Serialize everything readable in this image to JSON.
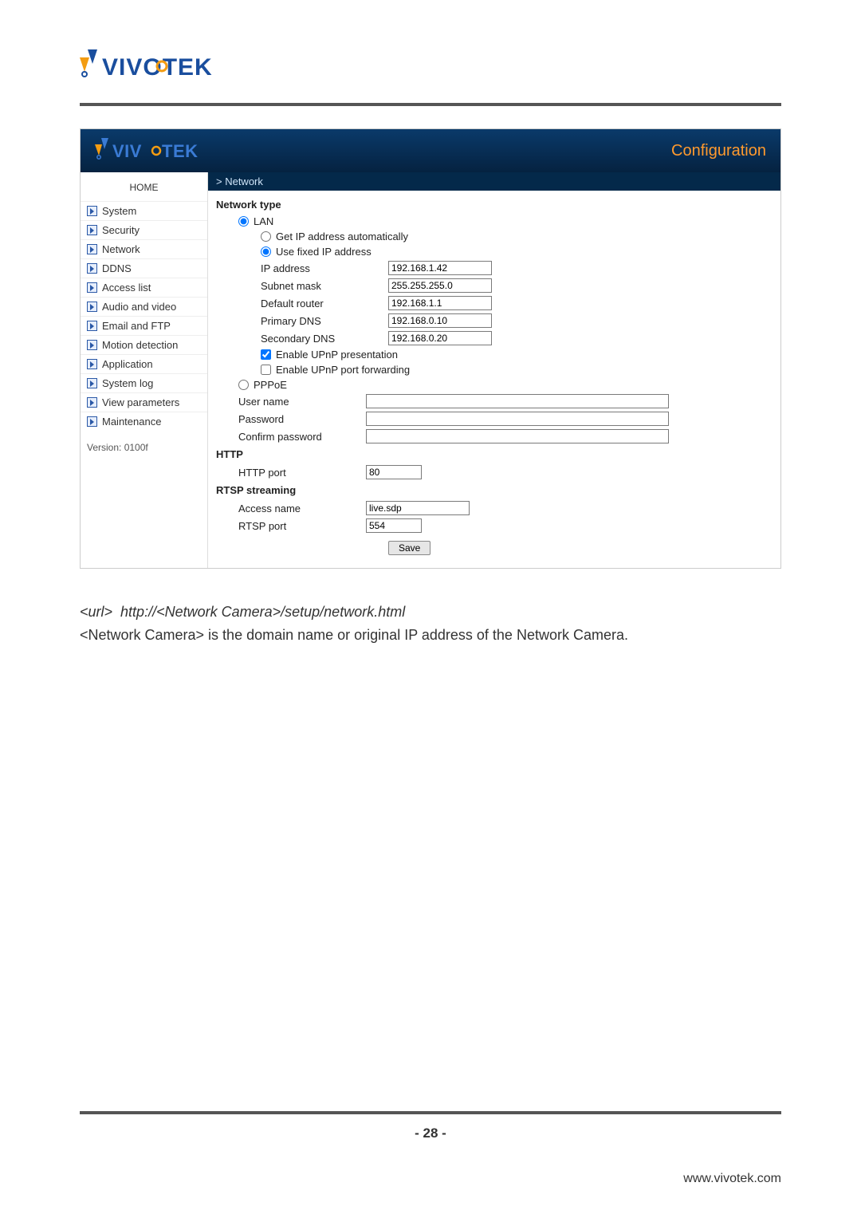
{
  "brand": "VIVOTEK",
  "config_title": "Configuration",
  "breadcrumb": "> Network",
  "sidebar": {
    "home": "HOME",
    "items": [
      "System",
      "Security",
      "Network",
      "DDNS",
      "Access list",
      "Audio and video",
      "Email and FTP",
      "Motion detection",
      "Application",
      "System log",
      "View parameters",
      "Maintenance"
    ],
    "version": "Version: 0100f"
  },
  "sections": {
    "network_type": "Network type",
    "lan": "LAN",
    "get_auto": "Get IP address automatically",
    "use_fixed": "Use fixed IP address",
    "ip_address_lbl": "IP address",
    "ip_address": "192.168.1.42",
    "subnet_lbl": "Subnet mask",
    "subnet": "255.255.255.0",
    "router_lbl": "Default router",
    "router": "192.168.1.1",
    "pdns_lbl": "Primary DNS",
    "pdns": "192.168.0.10",
    "sdns_lbl": "Secondary DNS",
    "sdns": "192.168.0.20",
    "upnp_pres": "Enable UPnP presentation",
    "upnp_port": "Enable UPnP port forwarding",
    "pppoe": "PPPoE",
    "user_lbl": "User name",
    "pass_lbl": "Password",
    "confirm_lbl": "Confirm password",
    "http_title": "HTTP",
    "http_port_lbl": "HTTP port",
    "http_port": "80",
    "rtsp_title": "RTSP streaming",
    "access_lbl": "Access name",
    "access": "live.sdp",
    "rtsp_port_lbl": "RTSP port",
    "rtsp_port": "554",
    "save": "Save"
  },
  "doc": {
    "url_prefix": "<url>",
    "url_value": "http://<Network Camera>/setup/network.html",
    "desc": "<Network Camera> is the domain name or original IP address of the Network Camera."
  },
  "footer": {
    "page": "- 28 -",
    "url": "www.vivotek.com"
  }
}
